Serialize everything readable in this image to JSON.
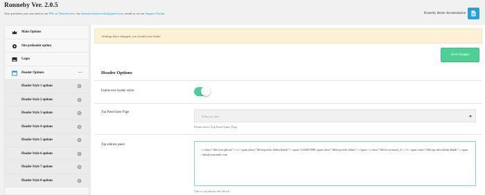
{
  "header": {
    "title": "Ronneby Ver. 2.0.5",
    "support": {
      "prefix": "Any questions you can send to our ",
      "pm_link": "PM on Themeforest",
      "mid1": ", via ",
      "email_link": "dynamicframeworks@gmail.com",
      "mid2": ", email or on our ",
      "forum_link": "Support Forum"
    },
    "docs_label": "Ronneby theme documentation",
    "docs_icon": "document-icon"
  },
  "sidebar": {
    "items": [
      {
        "label": "Main Options",
        "icon": "crown-icon"
      },
      {
        "label": "Site preloader option",
        "icon": "gear-icon"
      },
      {
        "label": "Logos",
        "icon": "image-icon"
      },
      {
        "label": "Header Options",
        "icon": "window-icon",
        "dots": "..."
      }
    ],
    "sub_items": [
      {
        "label": "Header Style 1 options"
      },
      {
        "label": "Header Style 2 options"
      },
      {
        "label": "Header Style 3 options"
      },
      {
        "label": "Header Style 4 options"
      },
      {
        "label": "Header Style 5 options"
      },
      {
        "label": "Header Style 6 options"
      },
      {
        "label": "Header Style 7 options"
      },
      {
        "label": "Header Style 8 options"
      }
    ]
  },
  "content": {
    "notice": "Settings have changed, you should save them!",
    "save_label": "Save Changes",
    "section_title": "Header Options",
    "fields": {
      "enable_header": {
        "label": "Enable new header styles",
        "value": true
      },
      "top_panel": {
        "label": "Top Panel Inner Page",
        "placeholder": "Select an item",
        "helper": "Please select Top Panel Inner Page"
      },
      "top_address": {
        "label": "Top address panel",
        "value": "<i class=\"dfd-icon-phone\"></i><span class=\"dfd-top-info-delim-blank\"></span>1234567890<span class=\"dfd-top-info-delim\"></span><i class=\"dfd-icon-email_2\"></i><span class=\"dfd-top-info-delim-blank\"></span>info@yourmail.com",
        "helper": "This is top adress info block."
      }
    }
  },
  "colors": {
    "accent_green": "#4dcf95",
    "link_blue": "#1b9bd1",
    "notice_bg": "#fcf1d6"
  }
}
